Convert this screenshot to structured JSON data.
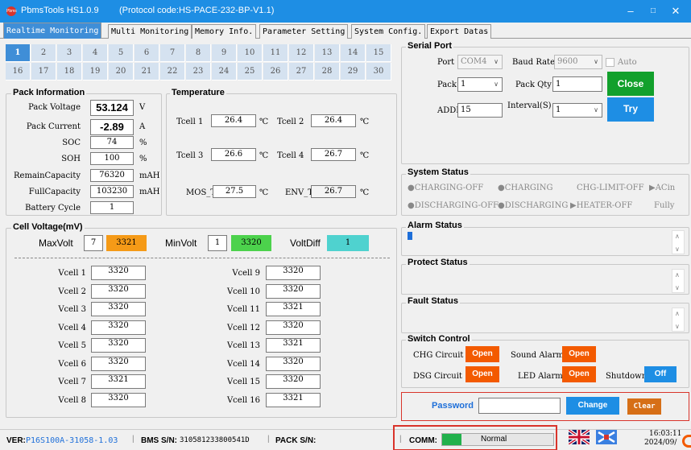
{
  "window": {
    "app_title": "PbmsTools HS1.0.9",
    "protocol": "(Protocol code:HS-PACE-232-BP-V1.1)",
    "logo_text": "Pbms"
  },
  "tabs": [
    "Realtime Monitoring",
    "Multi Monitoring",
    "Memory Info.",
    "Parameter Setting",
    "System Config.",
    "Export Datas"
  ],
  "pack_grid": {
    "row1": [
      "1",
      "2",
      "3",
      "4",
      "5",
      "6",
      "7",
      "8",
      "9",
      "10",
      "11",
      "12",
      "13",
      "14",
      "15"
    ],
    "row2": [
      "16",
      "17",
      "18",
      "19",
      "20",
      "21",
      "22",
      "23",
      "24",
      "25",
      "26",
      "27",
      "28",
      "29",
      "30"
    ],
    "selected": "1"
  },
  "pack_info": {
    "title": "Pack Information",
    "rows": [
      {
        "label": "Pack Voltage",
        "value": "53.124",
        "unit": "V"
      },
      {
        "label": "Pack Current",
        "value": "-2.89",
        "unit": "A"
      },
      {
        "label": "SOC",
        "value": "74",
        "unit": "%"
      },
      {
        "label": "SOH",
        "value": "100",
        "unit": "%"
      },
      {
        "label": "RemainCapacity",
        "value": "76320",
        "unit": "mAH"
      },
      {
        "label": "FullCapacity",
        "value": "103230",
        "unit": "mAH"
      },
      {
        "label": "Battery Cycle",
        "value": "1",
        "unit": ""
      }
    ]
  },
  "temperature": {
    "title": "Temperature",
    "unit": "℃",
    "tcell1": {
      "label": "Tcell 1",
      "value": "26.4"
    },
    "tcell2": {
      "label": "Tcell 2",
      "value": "26.4"
    },
    "tcell3": {
      "label": "Tcell 3",
      "value": "26.6"
    },
    "tcell4": {
      "label": "Tcell 4",
      "value": "26.7"
    },
    "mos": {
      "label": "MOS_T",
      "value": "27.5"
    },
    "env": {
      "label": "ENV_T",
      "value": "26.7"
    }
  },
  "cell_voltage": {
    "title": "Cell Voltage(mV)",
    "max": {
      "label": "MaxVolt",
      "index": "7",
      "value": "3321"
    },
    "min": {
      "label": "MinVolt",
      "index": "1",
      "value": "3320"
    },
    "diff": {
      "label": "VoltDiff",
      "value": "1"
    },
    "cells": [
      {
        "label": "Vcell 1",
        "value": "3320"
      },
      {
        "label": "Vcell 2",
        "value": "3320"
      },
      {
        "label": "Vcell 3",
        "value": "3320"
      },
      {
        "label": "Vcell 4",
        "value": "3320"
      },
      {
        "label": "Vcell 5",
        "value": "3320"
      },
      {
        "label": "Vcell 6",
        "value": "3320"
      },
      {
        "label": "Vcell 7",
        "value": "3321"
      },
      {
        "label": "Vcell 8",
        "value": "3320"
      },
      {
        "label": "Vcell 9",
        "value": "3320"
      },
      {
        "label": "Vcell 10",
        "value": "3320"
      },
      {
        "label": "Vcell 11",
        "value": "3321"
      },
      {
        "label": "Vcell 12",
        "value": "3320"
      },
      {
        "label": "Vcell 13",
        "value": "3321"
      },
      {
        "label": "Vcell 14",
        "value": "3320"
      },
      {
        "label": "Vcell 15",
        "value": "3320"
      },
      {
        "label": "Vcell 16",
        "value": "3321"
      }
    ]
  },
  "serial_port": {
    "title": "Serial Port",
    "port_label": "Port",
    "port_value": "COM4",
    "baud_label": "Baud Rate",
    "baud_value": "9600",
    "auto_label": "Auto",
    "pack_label": "Pack",
    "pack_value": "1",
    "packqty_label": "Pack Qty",
    "packqty_value": "1",
    "addr_label": "ADDR",
    "addr_value": "15",
    "interval_label": "Interval(S)",
    "interval_value": "1",
    "close_label": "Close",
    "try_label": "Try"
  },
  "system_status": {
    "title": "System Status",
    "items": [
      "CHARGING-OFF",
      "CHARGING",
      "CHG-LIMIT-OFF",
      "ACin",
      "DISCHARGING-OFF",
      "DISCHARGING",
      "HEATER-OFF",
      "Fully"
    ]
  },
  "alarm_status": {
    "title": "Alarm Status"
  },
  "protect_status": {
    "title": "Protect Status"
  },
  "fault_status": {
    "title": "Fault Status"
  },
  "switch_control": {
    "title": "Switch Control",
    "chg_label": "CHG Circuit",
    "chg_btn": "Open",
    "sound_label": "Sound Alarm",
    "sound_btn": "Open",
    "dsg_label": "DSG Circuit",
    "dsg_btn": "Open",
    "led_label": "LED Alarm",
    "led_btn": "Open",
    "shutdown_label": "Shutdown",
    "shutdown_btn": "Off"
  },
  "password": {
    "label": "Password",
    "change": "Change",
    "clear": "Clear"
  },
  "statusbar": {
    "ver_label": "VER:",
    "ver_value": "P16S100A-31058-1.03",
    "bms_label": "BMS S/N:",
    "bms_value": "310581233800541D",
    "pack_label": "PACK S/N:",
    "comm_label": "COMM:",
    "comm_value": "Normal",
    "time": "16:03:11",
    "date": "2024/09/"
  },
  "colors": {
    "titlebar": "#1e8ee4",
    "tab_active": "#3f8ed7",
    "close_btn": "#12a02c",
    "try_btn": "#1e8ee4",
    "open_btn": "#f35a00",
    "off_btn": "#1e8ee4",
    "max_volt": "#f59a17",
    "min_volt": "#4cd24c",
    "diff_volt": "#4fd2cf",
    "clear_btn": "#d66f17",
    "highlight_border": "#d9342b"
  }
}
